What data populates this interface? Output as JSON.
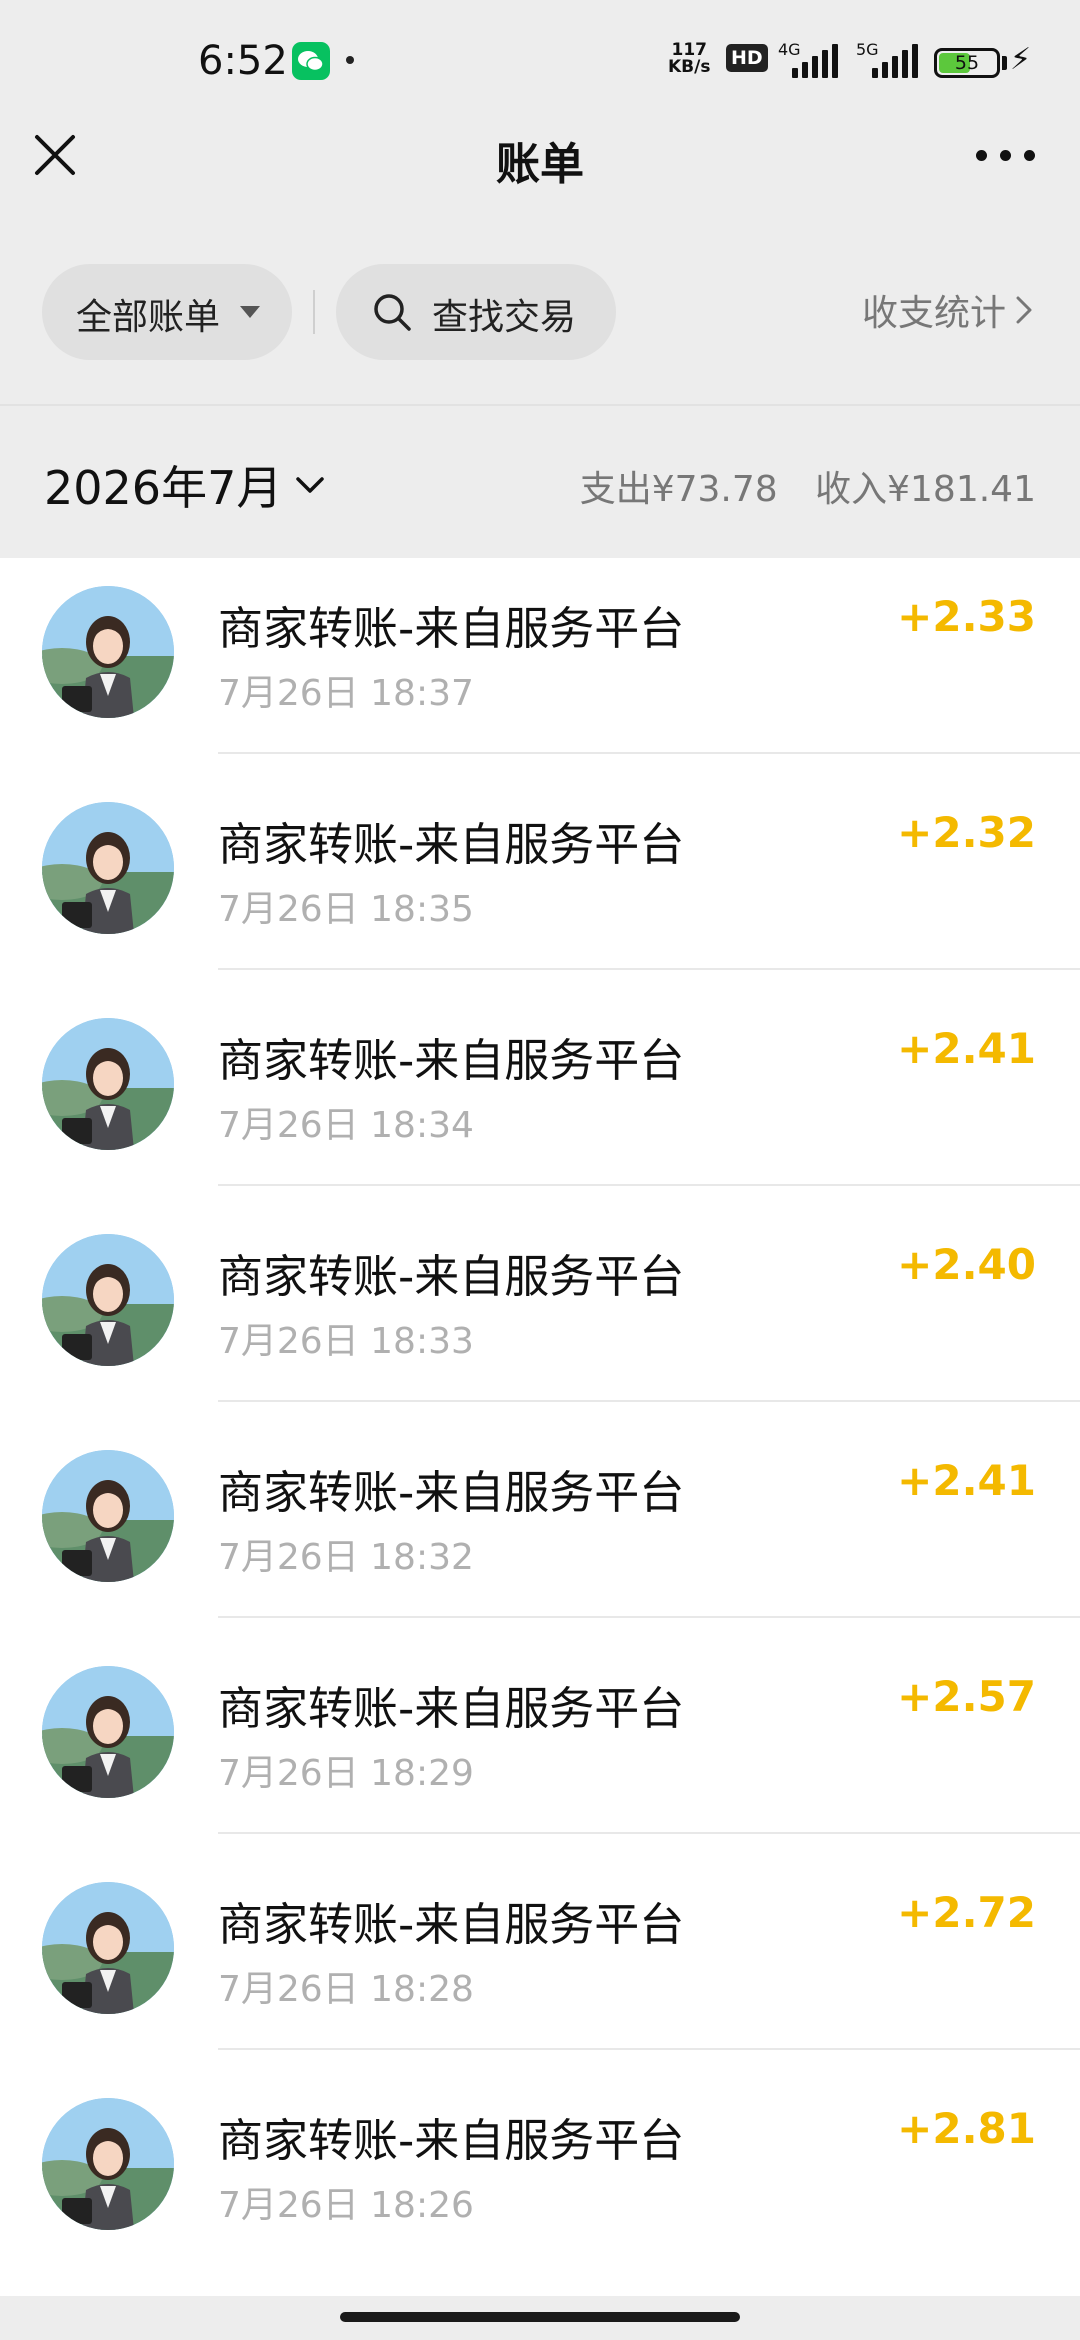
{
  "status_bar": {
    "time": "6:52",
    "net_speed_value": "117",
    "net_speed_unit": "KB/s",
    "hd_label": "HD",
    "network_4g": "4G",
    "network_5g": "5G",
    "battery": "55"
  },
  "nav": {
    "title": "账单"
  },
  "filters": {
    "all_bills": "全部账单",
    "search": "查找交易",
    "stats": "收支统计"
  },
  "month": {
    "label": "2026年7月",
    "expense": "支出¥73.78",
    "income": "收入¥181.41"
  },
  "transactions": [
    {
      "title": "商家转账-来自服务平台",
      "time": "7月26日 18:37",
      "amount": "+2.33"
    },
    {
      "title": "商家转账-来自服务平台",
      "time": "7月26日 18:35",
      "amount": "+2.32"
    },
    {
      "title": "商家转账-来自服务平台",
      "time": "7月26日 18:34",
      "amount": "+2.41"
    },
    {
      "title": "商家转账-来自服务平台",
      "time": "7月26日 18:33",
      "amount": "+2.40"
    },
    {
      "title": "商家转账-来自服务平台",
      "time": "7月26日 18:32",
      "amount": "+2.41"
    },
    {
      "title": "商家转账-来自服务平台",
      "time": "7月26日 18:29",
      "amount": "+2.57"
    },
    {
      "title": "商家转账-来自服务平台",
      "time": "7月26日 18:28",
      "amount": "+2.72"
    },
    {
      "title": "商家转账-来自服务平台",
      "time": "7月26日 18:26",
      "amount": "+2.81"
    }
  ],
  "colors": {
    "income_amount": "#f4b900",
    "background": "#ededed",
    "wechat_green": "#07c160"
  }
}
